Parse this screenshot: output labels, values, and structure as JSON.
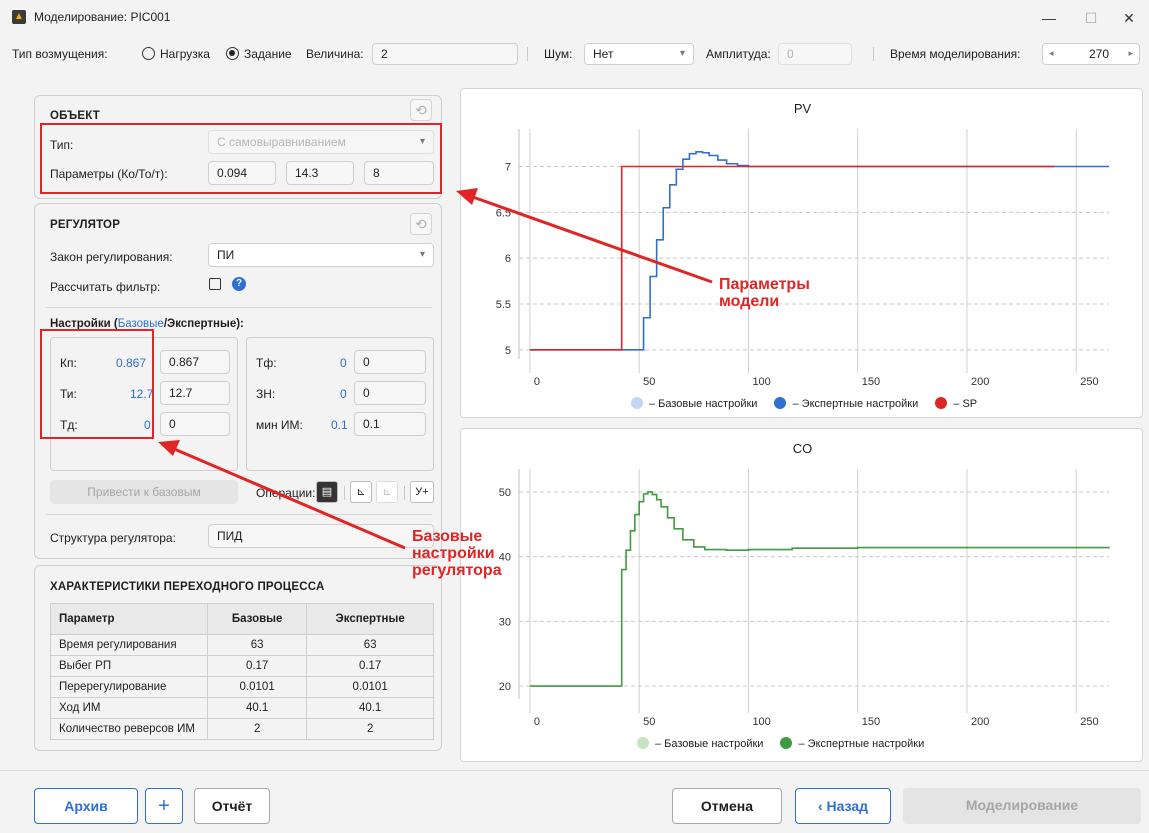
{
  "window": {
    "title": "Моделирование: PIC001"
  },
  "toolbar": {
    "disturbance_label": "Тип возмущения:",
    "load_option": "Нагрузка",
    "setpoint_option": "Задание",
    "magnitude_label": "Величина:",
    "magnitude_value": "2",
    "noise_label": "Шум:",
    "noise_value": "Нет",
    "amplitude_label": "Амплитуда:",
    "amplitude_value": "0",
    "simtime_label": "Время моделирования:",
    "simtime_value": "270"
  },
  "object": {
    "title": "ОБЪЕКТ",
    "type_label": "Тип:",
    "type_value": "С самовыравниванием",
    "params_label": "Параметры (Ко/То/т):",
    "k": "0.094",
    "T": "14.3",
    "tau": "8"
  },
  "regulator": {
    "title": "РЕГУЛЯТОР",
    "law_label": "Закон регулирования:",
    "law_value": "ПИ",
    "filter_label": "Рассчитать фильтр:",
    "settings_prefix": "Настройки (",
    "settings_base": "Базовые",
    "settings_suffix": "/Экспертные):",
    "kp_label": "Кп:",
    "kp_base": "0.867",
    "kp_exp": "0.867",
    "ti_label": "Ти:",
    "ti_base": "12.7",
    "ti_exp": "12.7",
    "td_label": "Тд:",
    "td_base": "0",
    "td_exp": "0",
    "tf_label": "Тф:",
    "tf_base": "0",
    "tf_exp": "0",
    "zn_label": "ЗН:",
    "zn_base": "0",
    "zn_exp": "0",
    "minim_label": "мин ИМ:",
    "minim_base": "0.1",
    "minim_exp": "0.1",
    "reset_button": "Привести к базовым",
    "operations_label": "Операции:",
    "yplus": "У+",
    "structure_label": "Структура регулятора:",
    "structure_value": "ПИД"
  },
  "characteristics": {
    "title": "ХАРАКТЕРИСТИКИ ПЕРЕХОДНОГО ПРОЦЕССА",
    "headers": [
      "Параметр",
      "Базовые",
      "Экспертные"
    ],
    "rows": [
      [
        "Время регулирования",
        "63",
        "63"
      ],
      [
        "Выбег РП",
        "0.17",
        "0.17"
      ],
      [
        "Перерегулирование",
        "0.0101",
        "0.0101"
      ],
      [
        "Ход ИМ",
        "40.1",
        "40.1"
      ],
      [
        "Количество реверсов ИМ",
        "2",
        "2"
      ]
    ]
  },
  "annotations": {
    "model_params_line1": "Параметры",
    "model_params_line2": "модели",
    "base_settings_line1": "Базовые",
    "base_settings_line2": "настройки",
    "base_settings_line3": "регулятора"
  },
  "legend": {
    "base": "–  Базовые настройки",
    "expert": "–  Экспертные настройки",
    "sp": "–  SP"
  },
  "colors": {
    "blue": "#2f6fd1",
    "red": "#e02525",
    "green": "#3f9a40",
    "light_blue": "#c4d5f2",
    "light_green": "#c6e3c6"
  },
  "chart_data": [
    {
      "type": "line",
      "title": "PV",
      "xlim": [
        -5,
        265
      ],
      "ylim": [
        4.9,
        7.3
      ],
      "xticks": [
        0,
        50,
        100,
        150,
        200,
        250
      ],
      "yticks": [
        5,
        5.5,
        6,
        6.5,
        7
      ],
      "series": [
        {
          "name": "Экспертные настройки",
          "color": "#2f6fd1",
          "x": [
            0,
            50,
            52,
            55,
            58,
            61,
            64,
            67,
            70,
            73,
            76,
            79,
            82,
            86,
            90,
            95,
            100,
            110,
            130,
            160,
            200,
            265
          ],
          "y": [
            5,
            5,
            5.35,
            5.8,
            6.2,
            6.55,
            6.8,
            6.97,
            7.08,
            7.14,
            7.16,
            7.15,
            7.12,
            7.07,
            7.03,
            7.01,
            7.0,
            7.0,
            7.0,
            7.0,
            7.0,
            7.0
          ]
        },
        {
          "name": "SP",
          "color": "#e02525",
          "x": [
            0,
            42,
            42,
            110,
            110,
            160,
            160,
            240
          ],
          "y": [
            5,
            5,
            7,
            7,
            7,
            7,
            7,
            7
          ]
        }
      ]
    },
    {
      "type": "line",
      "title": "CO",
      "xlim": [
        -5,
        265
      ],
      "ylim": [
        18,
        52
      ],
      "xticks": [
        0,
        50,
        100,
        150,
        200,
        250
      ],
      "yticks": [
        20,
        30,
        40,
        50
      ],
      "series": [
        {
          "name": "Экспертные настройки",
          "color": "#3f9a40",
          "x": [
            0,
            42,
            42,
            44,
            46,
            48,
            50,
            52,
            54,
            56,
            58,
            60,
            63,
            66,
            70,
            75,
            80,
            90,
            100,
            120,
            150,
            200,
            265
          ],
          "y": [
            20,
            20,
            38,
            41,
            44,
            46.5,
            48.5,
            49.7,
            50,
            49.6,
            48.8,
            47.7,
            46,
            44.3,
            42.6,
            41.5,
            41.1,
            41,
            41.1,
            41.3,
            41.4,
            41.4,
            41.5
          ]
        }
      ]
    }
  ]
}
